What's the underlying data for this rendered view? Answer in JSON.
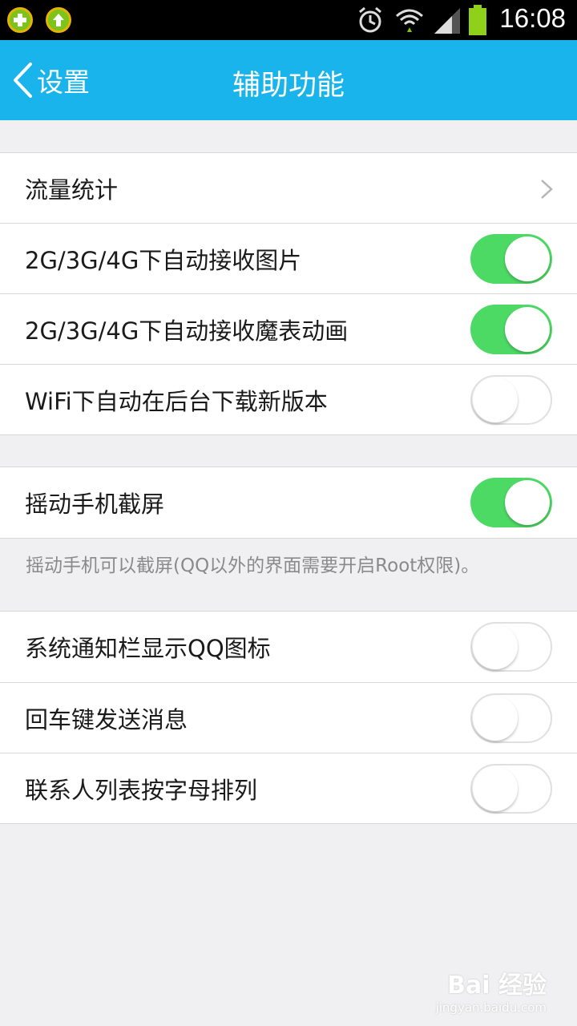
{
  "status_bar": {
    "time": "16:08",
    "icons": [
      "add-app-icon",
      "upload-icon",
      "alarm-icon",
      "wifi-icon",
      "signal-icon",
      "battery-icon"
    ]
  },
  "header": {
    "back_label": "设置",
    "title": "辅助功能",
    "background": "#19b4ec"
  },
  "groups": [
    {
      "items": [
        {
          "label": "流量统计",
          "type": "link"
        }
      ]
    },
    {
      "items": [
        {
          "label": "2G/3G/4G下自动接收图片",
          "type": "toggle",
          "on": true
        },
        {
          "label": "2G/3G/4G下自动接收魔表动画",
          "type": "toggle",
          "on": true
        },
        {
          "label": "WiFi下自动在后台下载新版本",
          "type": "toggle",
          "on": false
        }
      ]
    },
    {
      "items": [
        {
          "label": "摇动手机截屏",
          "type": "toggle",
          "on": true
        }
      ],
      "hint": "摇动手机可以截屏(QQ以外的界面需要开启Root权限)。"
    },
    {
      "items": [
        {
          "label": "系统通知栏显示QQ图标",
          "type": "toggle",
          "on": false
        },
        {
          "label": "回车键发送消息",
          "type": "toggle",
          "on": false
        },
        {
          "label": "联系人列表按字母排列",
          "type": "toggle",
          "on": false
        }
      ]
    }
  ],
  "toggle_on_color": "#4cd964",
  "watermark": {
    "main": "Bai 经验",
    "sub": "jingyan.baidu.com"
  }
}
